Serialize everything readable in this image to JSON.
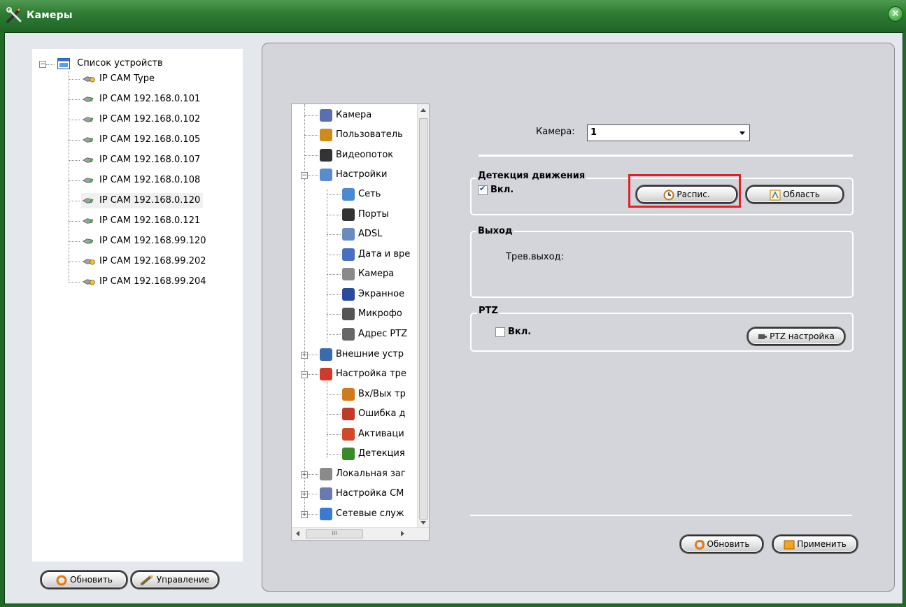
{
  "window": {
    "title": "Камеры",
    "close_symbol": "✕"
  },
  "devices": {
    "root": "Список устройств",
    "items": [
      {
        "label": "IP CAM Type",
        "type": "type"
      },
      {
        "label": "IP CAM 192.168.0.101",
        "type": "cam"
      },
      {
        "label": "IP CAM 192.168.0.102",
        "type": "cam"
      },
      {
        "label": "IP CAM 192.168.0.105",
        "type": "cam"
      },
      {
        "label": "IP CAM 192.168.0.107",
        "type": "cam"
      },
      {
        "label": "IP CAM 192.168.0.108",
        "type": "cam"
      },
      {
        "label": "IP CAM 192.168.0.120",
        "type": "cam",
        "selected": true
      },
      {
        "label": "IP CAM 192.168.0.121",
        "type": "cam"
      },
      {
        "label": "IP CAM 192.168.99.120",
        "type": "cam"
      },
      {
        "label": "IP CAM 192.168.99.202",
        "type": "type"
      },
      {
        "label": "IP CAM 192.168.99.204",
        "type": "type"
      }
    ]
  },
  "left_buttons": {
    "refresh": "Обновить",
    "manage": "Управление"
  },
  "nav": {
    "items": [
      {
        "label": "Камера"
      },
      {
        "label": "Пользователь"
      },
      {
        "label": "Видеопоток"
      },
      {
        "label": "Настройки"
      },
      {
        "label": "Сеть"
      },
      {
        "label": "Порты"
      },
      {
        "label": "ADSL"
      },
      {
        "label": "Дата и вре"
      },
      {
        "label": "Камера"
      },
      {
        "label": "Экранное"
      },
      {
        "label": "Микрофо"
      },
      {
        "label": "Адрес PTZ"
      },
      {
        "label": "Внешние устр"
      },
      {
        "label": "Настройка тре"
      },
      {
        "label": "Вх/Вых тр"
      },
      {
        "label": "Ошибка д"
      },
      {
        "label": "Активаци"
      },
      {
        "label": "Детекция"
      },
      {
        "label": "Локальная заг"
      },
      {
        "label": "Настройка СМ"
      },
      {
        "label": "Сетевые служ"
      }
    ]
  },
  "camera_select": {
    "label": "Камера:",
    "value": "1"
  },
  "motion": {
    "title": "Детекция движения",
    "enable_label": "Вкл.",
    "enabled": true,
    "schedule_btn": "Распис.",
    "area_btn": "Область"
  },
  "output": {
    "title": "Выход",
    "alarm_label": "Трев.выход:"
  },
  "ptz": {
    "title": "PTZ",
    "enable_label": "Вкл.",
    "enabled": false,
    "settings_btn": "PTZ настройка"
  },
  "bottom_buttons": {
    "refresh": "Обновить",
    "apply": "Применить"
  }
}
